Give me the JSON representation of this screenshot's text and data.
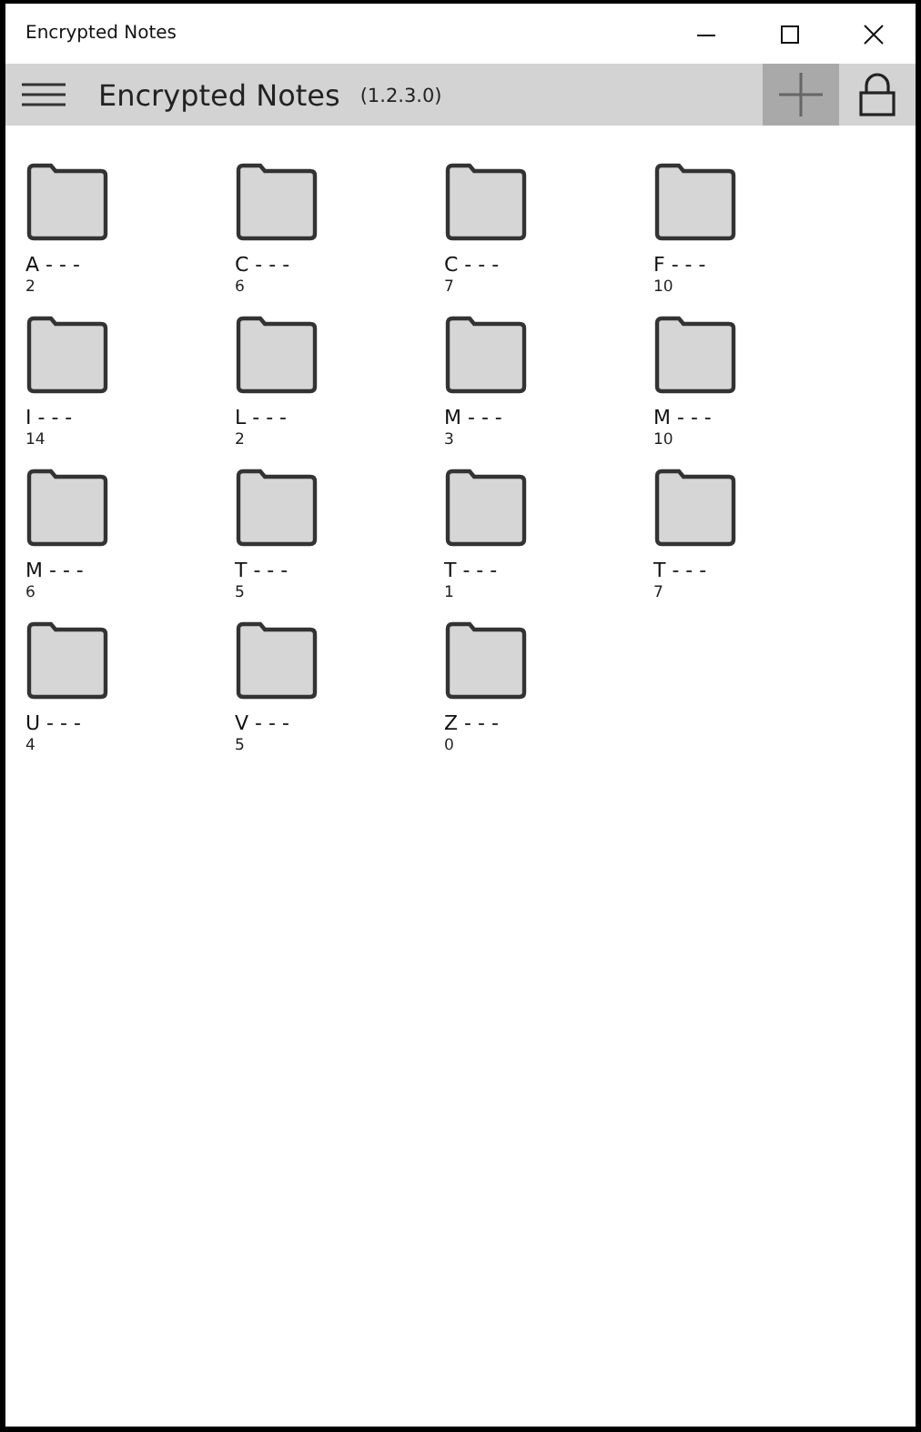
{
  "window": {
    "title": "Encrypted Notes"
  },
  "toolbar": {
    "title": "Encrypted Notes",
    "version": "(1.2.3.0)"
  },
  "folders": [
    {
      "name": "A - - -",
      "count": "2"
    },
    {
      "name": "C - - -",
      "count": "6"
    },
    {
      "name": "C - - -",
      "count": "7"
    },
    {
      "name": "F - - -",
      "count": "10"
    },
    {
      "name": "I - - -",
      "count": "14"
    },
    {
      "name": "L - - -",
      "count": "2"
    },
    {
      "name": "M - - -",
      "count": "3"
    },
    {
      "name": "M - - -",
      "count": "10"
    },
    {
      "name": "M - - -",
      "count": "6"
    },
    {
      "name": "T - - -",
      "count": "5"
    },
    {
      "name": "T - - -",
      "count": "1"
    },
    {
      "name": "T - - -",
      "count": "7"
    },
    {
      "name": "U - - -",
      "count": "4"
    },
    {
      "name": "V - - -",
      "count": "5"
    },
    {
      "name": "Z - - -",
      "count": "0"
    }
  ]
}
